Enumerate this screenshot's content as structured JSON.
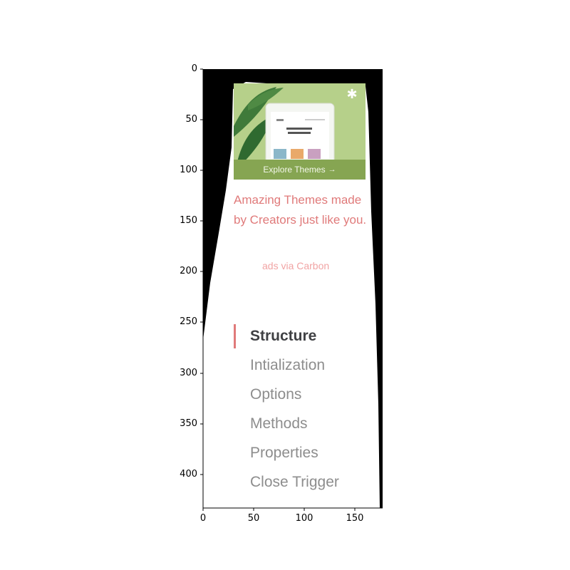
{
  "ad": {
    "cta_label": "Explore Themes",
    "cta_arrow": "→",
    "badge_icon": "✱",
    "text": "Amazing Themes made by Creators just like you.",
    "via": "ads via Carbon",
    "colors": {
      "image_bg": "#b6d08a",
      "cta_bg": "#86a552",
      "text": "#e07a7a",
      "via": "#f1a4a4"
    }
  },
  "toc": {
    "items": [
      {
        "label": "Structure",
        "active": true
      },
      {
        "label": "Intialization",
        "active": false
      },
      {
        "label": "Options",
        "active": false
      },
      {
        "label": "Methods",
        "active": false
      },
      {
        "label": "Properties",
        "active": false
      },
      {
        "label": "Close Trigger",
        "active": false
      }
    ],
    "marker_color": "#e07a7a"
  },
  "axes": {
    "y_ticks": [
      "0",
      "50",
      "100",
      "150",
      "200",
      "250",
      "300",
      "350",
      "400"
    ],
    "x_ticks": [
      "0",
      "50",
      "100",
      "150"
    ]
  }
}
